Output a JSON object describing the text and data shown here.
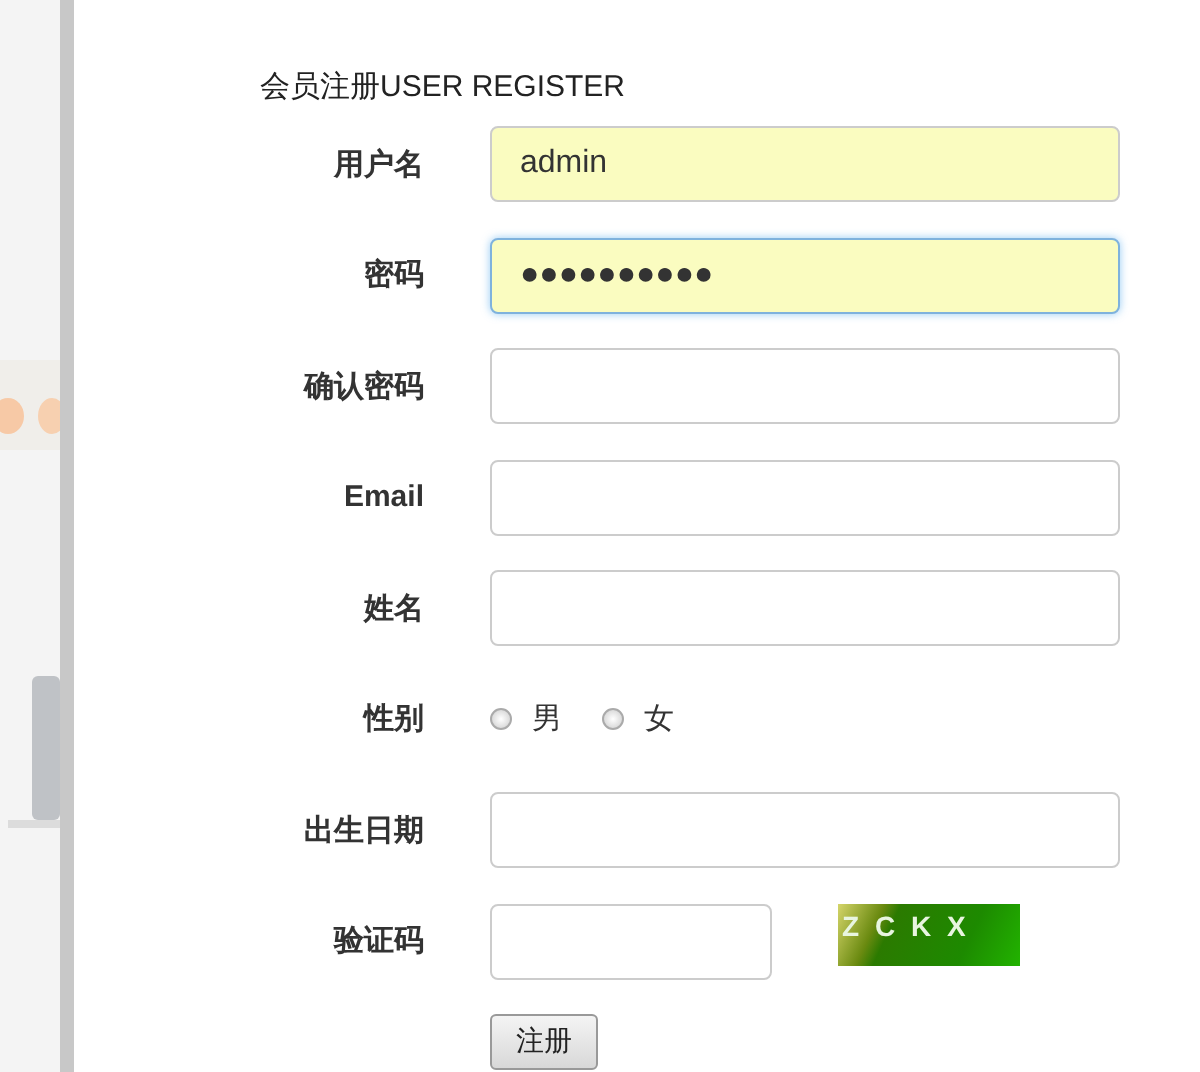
{
  "form": {
    "title": "会员注册USER REGISTER",
    "fields": [
      {
        "kind": "text",
        "label": "用户名",
        "value": "admin",
        "autofilled": true,
        "focused": false
      },
      {
        "kind": "text",
        "label": "密码",
        "value": "●●●●●●●●●●",
        "autofilled": true,
        "focused": true
      },
      {
        "kind": "text",
        "label": "确认密码",
        "autofilled": false,
        "focused": false
      },
      {
        "kind": "text",
        "label": "Email",
        "autofilled": false,
        "focused": false
      },
      {
        "kind": "text",
        "label": "姓名",
        "autofilled": false,
        "focused": false
      },
      {
        "kind": "radio",
        "label": "性别",
        "options": [
          {
            "label": "男",
            "selected": false
          },
          {
            "label": "女",
            "selected": false
          }
        ]
      },
      {
        "kind": "text",
        "label": "出生日期",
        "autofilled": false,
        "focused": false
      },
      {
        "kind": "captcha",
        "label": "验证码",
        "code": "Z C K X"
      }
    ],
    "submit": "注册"
  }
}
